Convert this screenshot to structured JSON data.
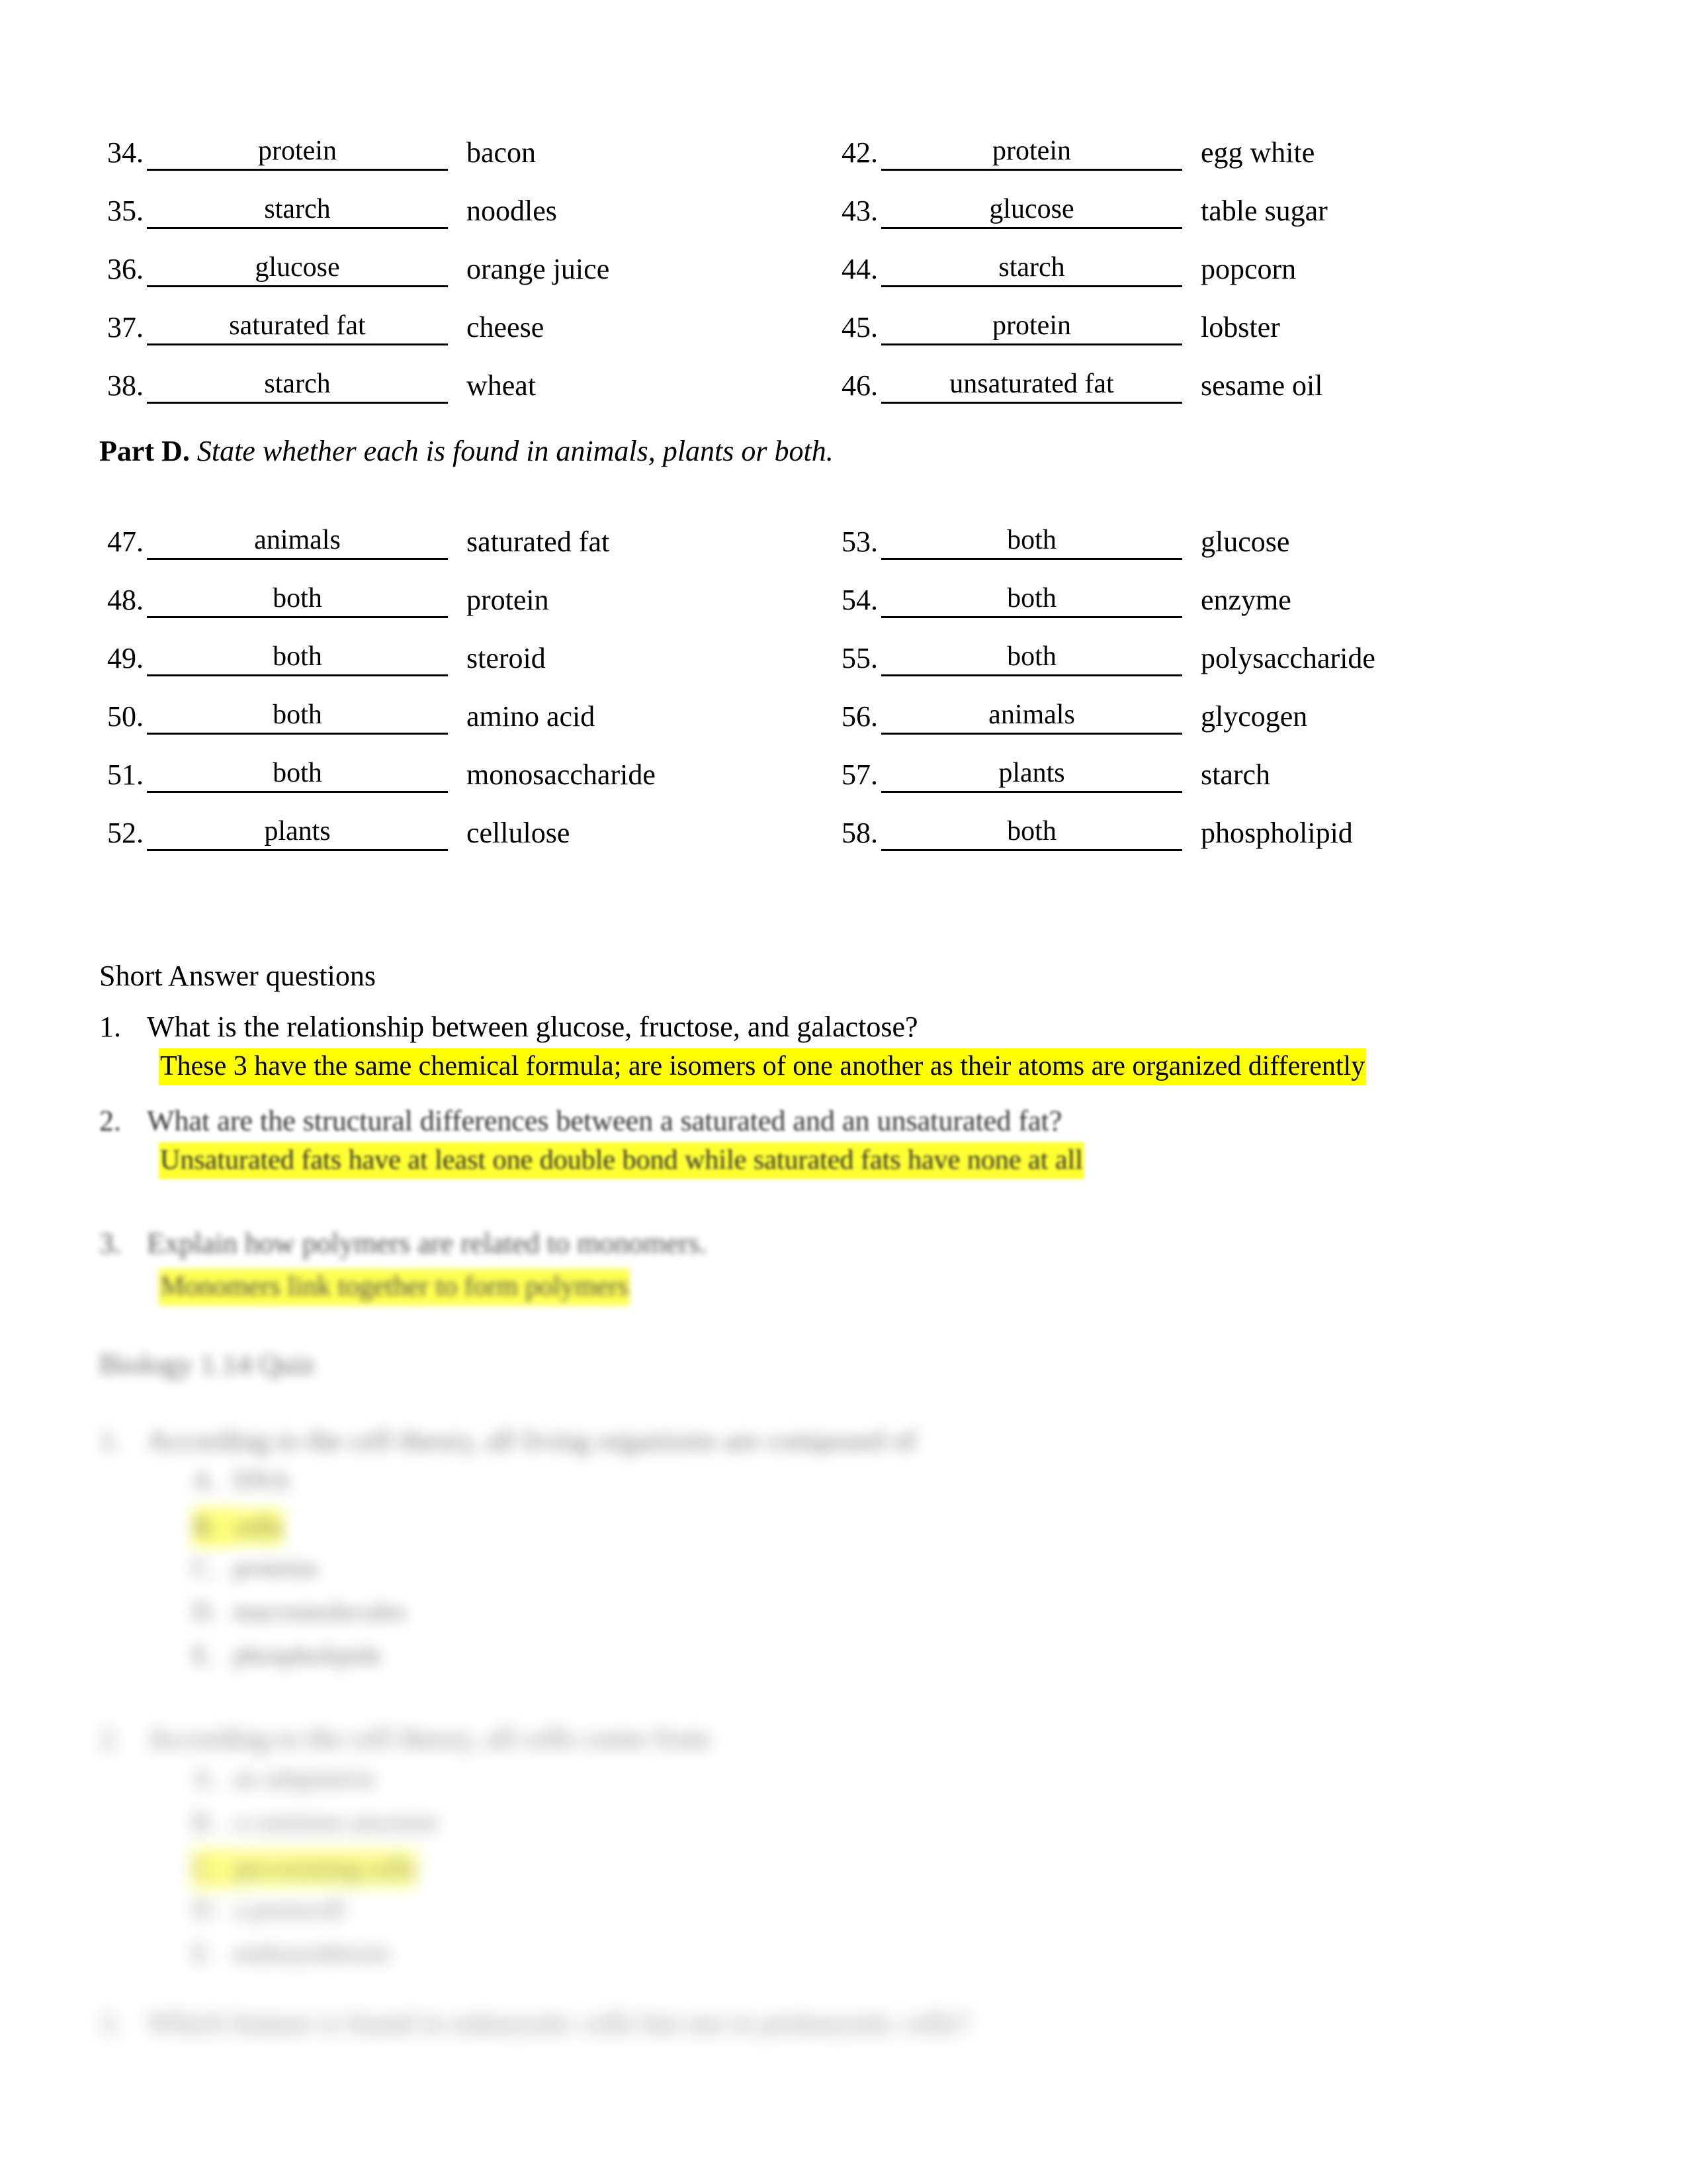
{
  "document": {
    "part_c": {
      "left_items": [
        {
          "num": "34.",
          "answer": "protein",
          "label": "bacon"
        },
        {
          "num": "35.",
          "answer": "starch",
          "label": "noodles"
        },
        {
          "num": "36.",
          "answer": "glucose",
          "label": "orange juice"
        },
        {
          "num": "37.",
          "answer": "saturated fat",
          "label": "cheese"
        },
        {
          "num": "38.",
          "answer": "starch",
          "label": "wheat"
        }
      ],
      "right_items": [
        {
          "num": "42.",
          "answer": "protein",
          "label": "egg white"
        },
        {
          "num": "43.",
          "answer": "glucose",
          "label": "table sugar"
        },
        {
          "num": "44.",
          "answer": "starch",
          "label": "popcorn"
        },
        {
          "num": "45.",
          "answer": "protein",
          "label": "lobster"
        },
        {
          "num": "46.",
          "answer": "unsaturated fat",
          "label": "sesame oil"
        }
      ]
    },
    "part_d": {
      "heading_bold": "Part D.",
      "heading_italic": "State whether each is found in animals, plants or both.",
      "left_items": [
        {
          "num": "47.",
          "answer": "animals",
          "label": "saturated fat"
        },
        {
          "num": "48.",
          "answer": "both",
          "label": "protein"
        },
        {
          "num": "49.",
          "answer": "both",
          "label": "steroid"
        },
        {
          "num": "50.",
          "answer": "both",
          "label": "amino acid"
        },
        {
          "num": "51.",
          "answer": "both",
          "label": "monosaccharide"
        },
        {
          "num": "52.",
          "answer": "plants",
          "label": "cellulose"
        }
      ],
      "right_items": [
        {
          "num": "53.",
          "answer": "both",
          "label": "glucose"
        },
        {
          "num": "54.",
          "answer": "both",
          "label": "enzyme"
        },
        {
          "num": "55.",
          "answer": "both",
          "label": "polysaccharide"
        },
        {
          "num": "56.",
          "answer": "animals",
          "label": "glycogen"
        },
        {
          "num": "57.",
          "answer": "plants",
          "label": "starch"
        },
        {
          "num": "58.",
          "answer": "both",
          "label": "phospholipid"
        }
      ]
    },
    "short_answer": {
      "title": "Short Answer questions",
      "q1_num": "1.",
      "q1_text": "What is the relationship between glucose, fructose, and galactose?",
      "q1_answer": "These 3 have the same chemical formula; are isomers of one another as their atoms are organized differently",
      "q2_num": "2.",
      "q2_text": "What are the structural differences between a saturated and an unsaturated fat?",
      "q2_answer": "Unsaturated fats have at least one double bond while saturated fats have none at all",
      "q3_num": "3.",
      "q3_text": "Explain how polymers are related to monomers.",
      "q3_answer": "Monomers link together to form polymers"
    },
    "multiple_choice": {
      "heading": "Biology 1.14 Quiz",
      "questions": [
        {
          "num": "1.",
          "text": "According to the cell theory, all living organisms are composed of",
          "options": [
            {
              "letter": "A.",
              "text": "DNA",
              "highlight": false
            },
            {
              "letter": "B.",
              "text": "cells",
              "highlight": true
            },
            {
              "letter": "C.",
              "text": "proteins",
              "highlight": false
            },
            {
              "letter": "D.",
              "text": "macromolecules",
              "highlight": false
            },
            {
              "letter": "E.",
              "text": "phospholipids",
              "highlight": false
            }
          ]
        },
        {
          "num": "2.",
          "text": "According to the cell theory, all cells come from",
          "options": [
            {
              "letter": "A.",
              "text": "an adaptation",
              "highlight": false
            },
            {
              "letter": "B.",
              "text": "a common ancestor",
              "highlight": false
            },
            {
              "letter": "C.",
              "text": "pre-existing cells",
              "highlight": true
            },
            {
              "letter": "D.",
              "text": "a protocell",
              "highlight": false
            },
            {
              "letter": "E.",
              "text": "endosymbiosis",
              "highlight": false
            }
          ]
        },
        {
          "num": "3.",
          "text": "Which feature is found in eukaryotic cells but not in prokaryotic cells?",
          "options": []
        }
      ]
    }
  },
  "colors": {
    "highlight": "#ffff00",
    "text": "#000000",
    "page_background": "#ffffff"
  }
}
